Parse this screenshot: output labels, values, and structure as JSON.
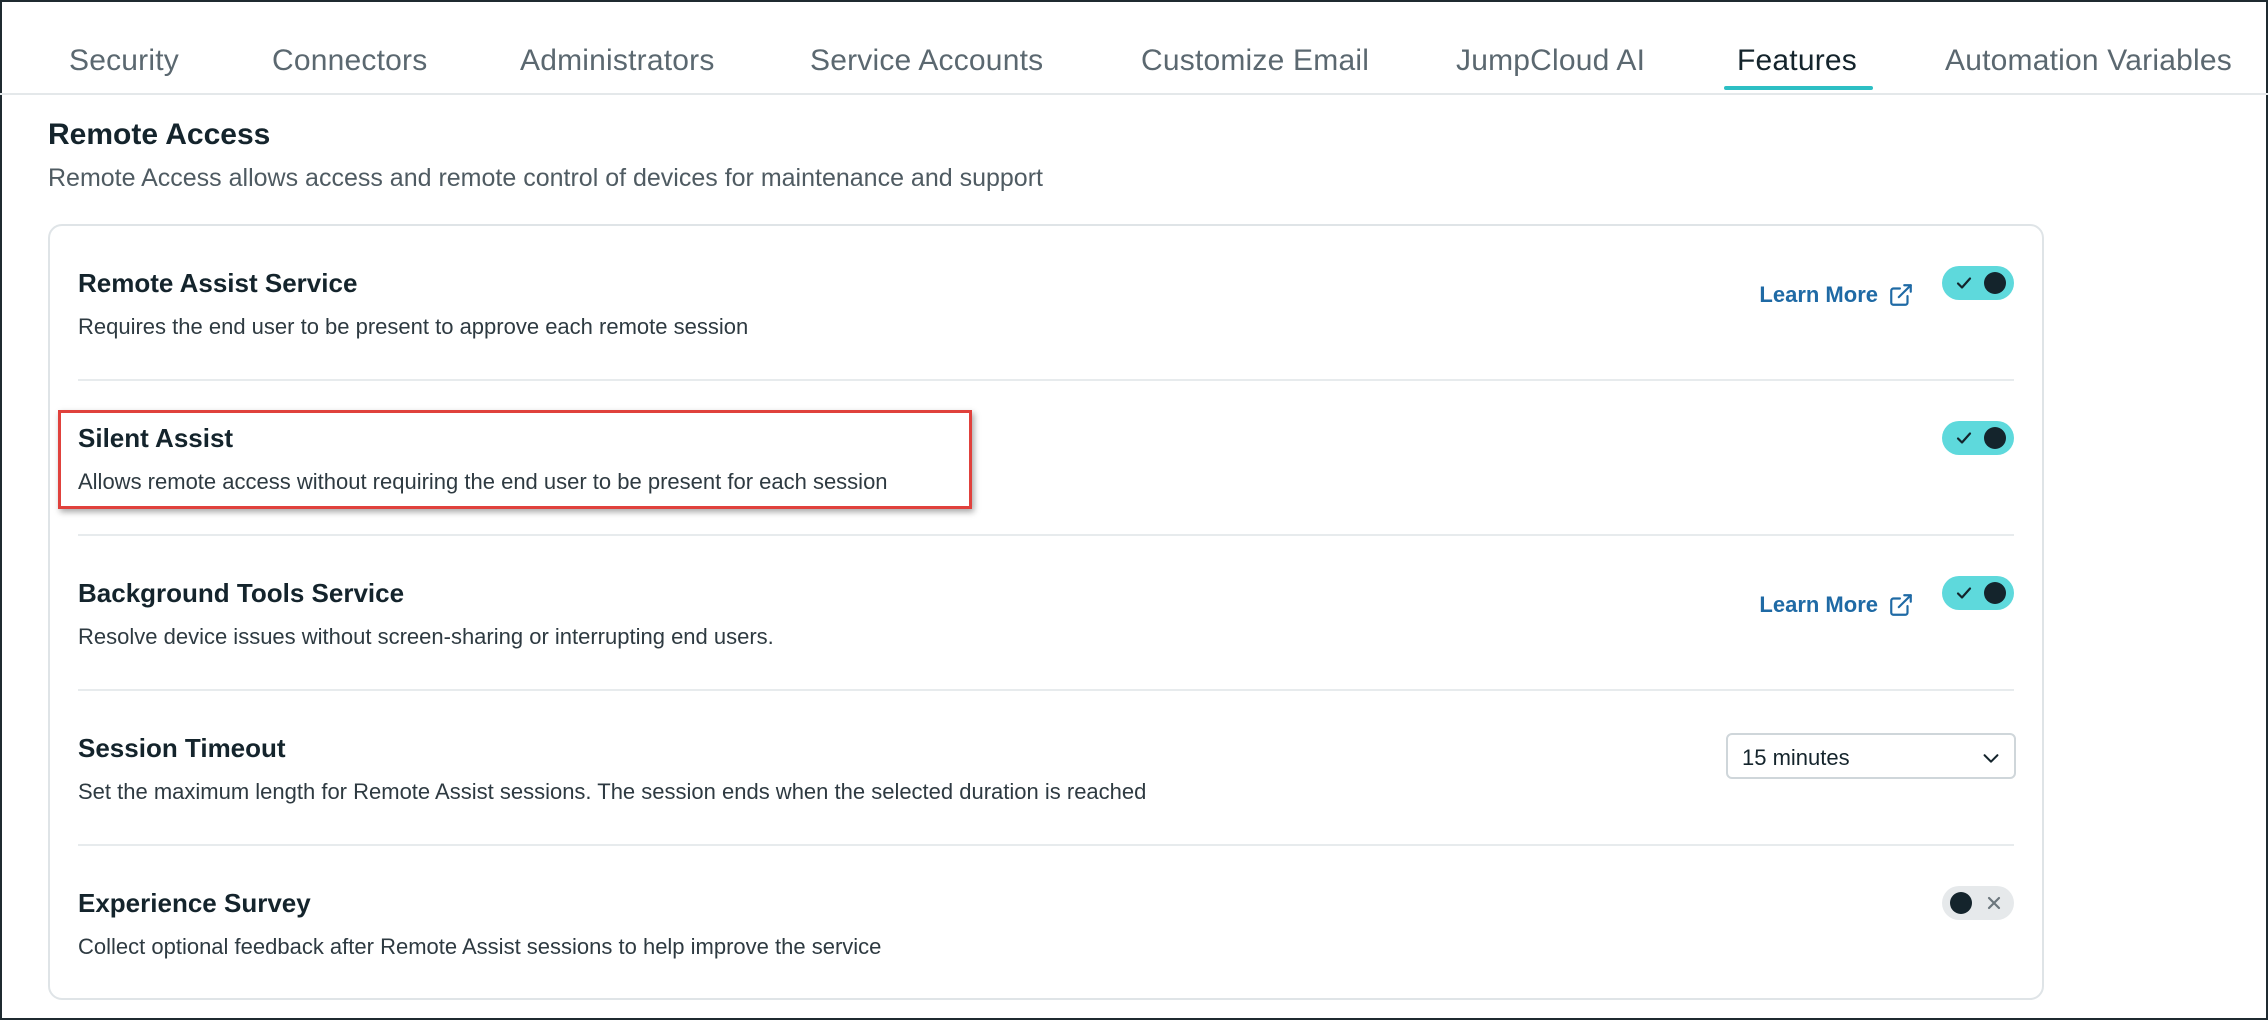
{
  "tabs": [
    {
      "label": "Security",
      "active": false
    },
    {
      "label": "Connectors",
      "active": false
    },
    {
      "label": "Administrators",
      "active": false
    },
    {
      "label": "Service Accounts",
      "active": false
    },
    {
      "label": "Customize Email",
      "active": false
    },
    {
      "label": "JumpCloud AI",
      "active": false
    },
    {
      "label": "Features",
      "active": true
    },
    {
      "label": "Automation Variables",
      "active": false
    }
  ],
  "section": {
    "title": "Remote Access",
    "subtitle": "Remote Access allows access and remote control of devices for maintenance and support"
  },
  "settings": [
    {
      "title": "Remote Assist Service",
      "description": "Requires the end user to be present to approve each remote session",
      "learn_more": "Learn More",
      "enabled": true
    },
    {
      "title": "Silent Assist",
      "description": "Allows remote access without requiring the end user to be present for each session",
      "enabled": true
    },
    {
      "title": "Background Tools Service",
      "description": "Resolve device issues without screen-sharing or interrupting end users.",
      "learn_more": "Learn More",
      "enabled": true
    },
    {
      "title": "Session Timeout",
      "description": "Set the maximum length for Remote Assist sessions. The session ends when the selected duration is reached",
      "select_value": "15 minutes"
    },
    {
      "title": "Experience Survey",
      "description": "Collect optional feedback after Remote Assist sessions to help improve the service",
      "enabled": false
    }
  ],
  "icons": {
    "learn_more": "external-link-icon",
    "toggle_on": "check-icon",
    "toggle_off": "x-icon",
    "select": "chevron-down-icon"
  },
  "colors": {
    "accent": "#2dbfc4",
    "toggle_on": "#5ed9dc",
    "link": "#1f6aa5",
    "highlight": "#e0413c"
  }
}
